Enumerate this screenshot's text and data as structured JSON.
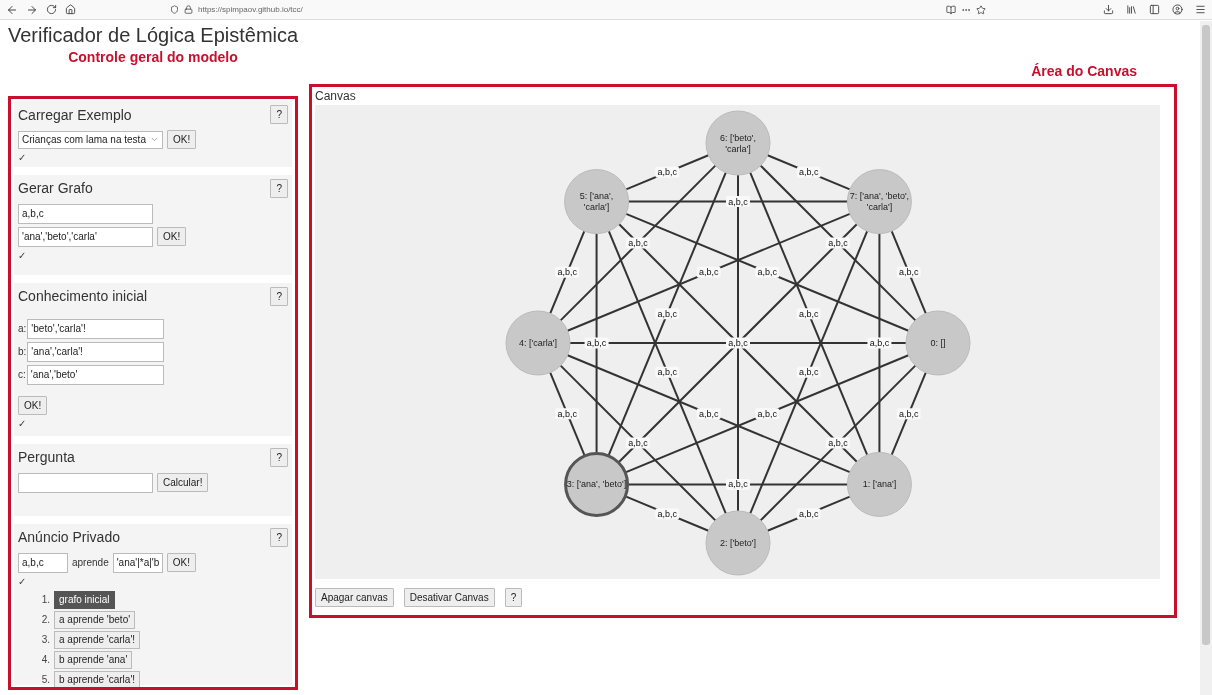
{
  "browser": {
    "url": "https://spimpaov.github.io/tcc/"
  },
  "page_title": "Verificador de Lógica Epistêmica",
  "control_panel": {
    "caption": "Controle geral do modelo",
    "sections": [
      {
        "kind": "example",
        "title": "Carregar Exemplo",
        "help": "?",
        "select": "Crianças com lama na testa",
        "button": "OK!",
        "status": "✓"
      },
      {
        "kind": "generate",
        "title": "Gerar Grafo",
        "help": "?",
        "fields": [
          "a,b,c",
          "'ana','beto','carla'"
        ],
        "button": "OK!",
        "status": "✓"
      },
      {
        "kind": "knowledge",
        "title": "Conhecimento inicial",
        "help": "?",
        "agents": [
          {
            "label": "a:",
            "value": "'beto','carla'!"
          },
          {
            "label": "b:",
            "value": "'ana','carla'!"
          },
          {
            "label": "c:",
            "value": "'ana','beto'"
          }
        ],
        "button": "OK!",
        "status": "✓"
      },
      {
        "kind": "question",
        "title": "Pergunta",
        "help": "?",
        "button": "Calcular!"
      },
      {
        "kind": "announcement",
        "title": "Anúncio Privado",
        "help": "?",
        "agents_field": "a,b,c",
        "verb": "aprende",
        "formula_field": "'ana'|*a|'b",
        "button": "OK!",
        "status": "✓",
        "history": [
          {
            "number": "1.",
            "label": "grafo inicial",
            "selected": true
          },
          {
            "number": "2.",
            "label": "a aprende 'beto'",
            "selected": false
          },
          {
            "number": "3.",
            "label": "a aprende 'carla'!",
            "selected": false
          },
          {
            "number": "4.",
            "label": "b aprende 'ana'",
            "selected": false
          },
          {
            "number": "5.",
            "label": "b aprende 'carla'!",
            "selected": false
          }
        ]
      }
    ]
  },
  "canvas_area": {
    "caption": "Área do Canvas",
    "title": "Canvas",
    "graph": {
      "nodes": [
        {
          "lines": [
            "0: []"
          ],
          "selected": false
        },
        {
          "lines": [
            "1: ['ana']"
          ],
          "selected": false
        },
        {
          "lines": [
            "2: ['beto']"
          ],
          "selected": false
        },
        {
          "lines": [
            "3: ['ana', 'beto']"
          ],
          "selected": true
        },
        {
          "lines": [
            "4: ['carla']"
          ],
          "selected": false
        },
        {
          "lines": [
            "5: ['ana',",
            "'carla']"
          ],
          "selected": false
        },
        {
          "lines": [
            "6: ['beto',",
            "'carla']"
          ],
          "selected": false
        },
        {
          "lines": [
            "7: ['ana', 'beto',",
            "'carla']"
          ],
          "selected": false
        }
      ],
      "edges": [
        {
          "kind": "edge",
          "label": "a,b,c"
        },
        {
          "kind": "edge",
          "label": "a,b,c"
        },
        {
          "kind": "edge",
          "label": "a,b,c"
        },
        {
          "kind": "edge",
          "label": "a,b,c"
        },
        {
          "kind": "edge",
          "label": "a,b,c"
        },
        {
          "kind": "edge",
          "label": "a,b,c"
        },
        {
          "kind": "edge",
          "label": "a,b,c"
        },
        {
          "kind": "edge",
          "label": "a,b,c"
        },
        {
          "kind": "edge",
          "label": "a,b,c"
        },
        {
          "kind": "edge",
          "label": "a,b,c"
        },
        {
          "kind": "edge",
          "label": "a,b,c"
        },
        {
          "kind": "edge",
          "label": "a,b,c"
        },
        {
          "kind": "edge",
          "label": "a,b,c"
        },
        {
          "kind": "edge",
          "label": "a,b,c"
        },
        {
          "kind": "edge",
          "label": "a,b,c"
        },
        {
          "kind": "edge",
          "label": "a,b,c"
        },
        {
          "kind": "edge",
          "label": "a,b,c"
        },
        {
          "kind": "edge",
          "label": "a,b,c"
        },
        {
          "kind": "edge",
          "label": "a,b,c"
        },
        {
          "kind": "edge",
          "label": "a,b,c"
        },
        {
          "kind": "edge",
          "label": "a,b,c"
        },
        {
          "kind": "edge",
          "label": "a,b,c"
        },
        {
          "kind": "edge",
          "label": "a,b,c"
        },
        {
          "kind": "edge",
          "label": "a,b,c"
        },
        {
          "kind": "edge",
          "label": "a,b,c"
        },
        {
          "kind": "edge"
        },
        {
          "kind": "edge"
        },
        {
          "kind": "edge"
        }
      ]
    },
    "buttons": [
      "Apagar canvas",
      "Desativar Canvas",
      "?"
    ]
  }
}
